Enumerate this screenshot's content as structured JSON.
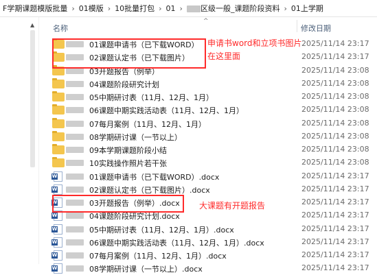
{
  "breadcrumb": {
    "items": [
      "F学期课题模版批量",
      "01模版",
      "10批量打包",
      "01",
      "区级一般_课题阶段资料",
      "01上学期"
    ],
    "separator": "›"
  },
  "columns": {
    "name": "名称",
    "date": "修改日期"
  },
  "files": [
    {
      "type": "folder",
      "name": "01课题申请书（已下载WORD）",
      "date": "2025/11/14 23:17"
    },
    {
      "type": "folder",
      "name": "02课题认定书（已下载图片）",
      "date": "2025/11/14 23:17"
    },
    {
      "type": "folder",
      "name": "03开题报告（例举）",
      "date": "2025/11/14 23:08"
    },
    {
      "type": "folder",
      "name": "04课题阶段研究计划",
      "date": "2025/11/14 23:08"
    },
    {
      "type": "folder",
      "name": "05中期研讨表（11月、12月、1月）",
      "date": "2025/11/14 23:08"
    },
    {
      "type": "folder",
      "name": "06课题中期实践活动表（11月、12月、1月）",
      "date": "2025/11/14 23:08"
    },
    {
      "type": "folder",
      "name": "07每月案例（11月、12月、1月）",
      "date": "2025/11/14 23:08"
    },
    {
      "type": "folder",
      "name": "08学期研讨课（一节以上）",
      "date": "2025/11/14 23:08"
    },
    {
      "type": "folder",
      "name": "09本学期课题阶段小结",
      "date": "2025/11/14 23:08"
    },
    {
      "type": "folder",
      "name": "10实践操作照片若干张",
      "date": "2025/11/14 23:08"
    },
    {
      "type": "word",
      "name": "01课题申请书（已下载WORD）.docx",
      "date": "2025/11/14 23:17"
    },
    {
      "type": "word",
      "name": "02课题认定书（已下载图片）.docx",
      "date": "2025/11/14 23:17"
    },
    {
      "type": "word",
      "name": "03开题报告（例举）.docx",
      "date": "2025/11/14 23:17"
    },
    {
      "type": "word",
      "name": "04课题阶段研究计划.docx",
      "date": "2025/11/14 23:17"
    },
    {
      "type": "word",
      "name": "05中期研讨表（11月、12月、1月）.docx",
      "date": "2025/11/14 23:17"
    },
    {
      "type": "word",
      "name": "06课题中期实践活动表（11月、12月、1月）.docx",
      "date": "2025/11/14 23:17"
    },
    {
      "type": "word",
      "name": "07每月案例（11月、12月、1月）.docx",
      "date": "2025/11/14 23:17"
    },
    {
      "type": "word",
      "name": "08学期研讨课（一节以上）.docx",
      "date": "2025/11/14 23:17"
    }
  ],
  "annotations": {
    "top_line1": "申请书word和立项书图片",
    "top_line2": "在这里面",
    "bottom": "大课题有开题报告"
  },
  "colors": {
    "annotation": "#ff2a2a",
    "folder": "#f4c64e",
    "word": "#2b5797"
  }
}
